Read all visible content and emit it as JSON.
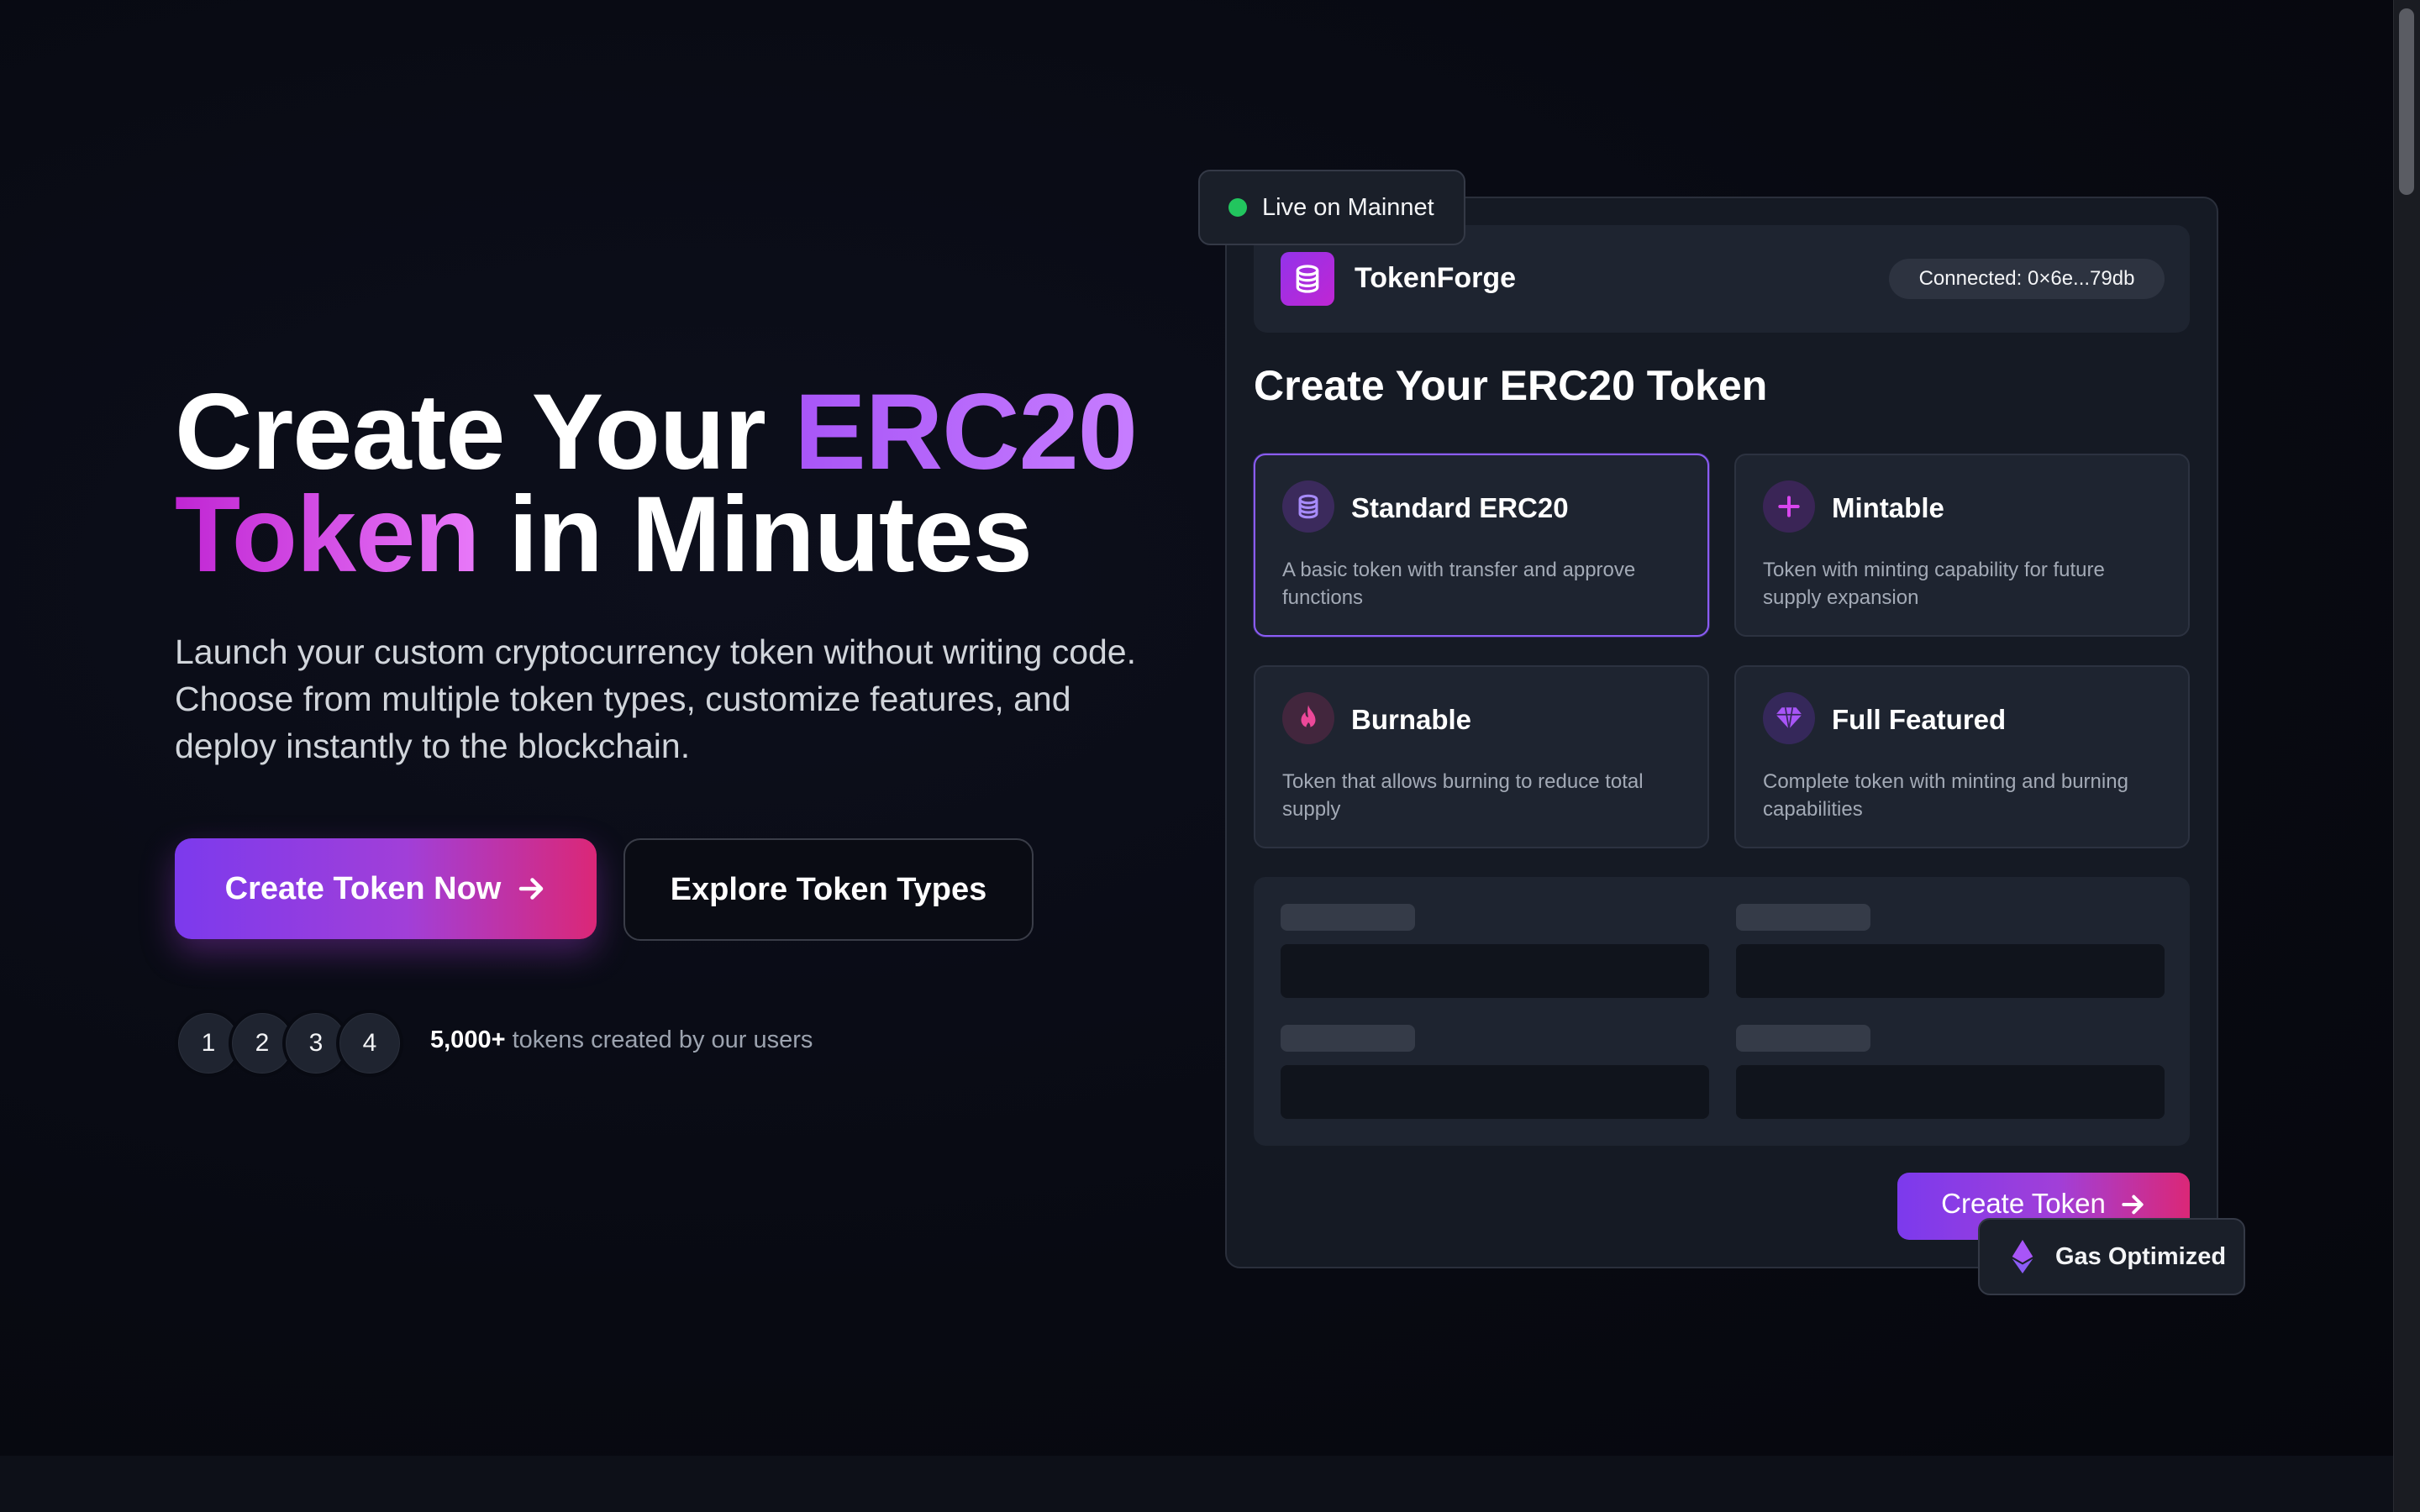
{
  "hero": {
    "title_part1": "Create Your ",
    "title_part2": "ERC20",
    "title_part3": "Token",
    "title_part4": " in Minutes",
    "description": "Launch your custom cryptocurrency token without writing code. Choose from multiple token types, customize features, and deploy instantly to the blockchain.",
    "primary_button": "Create Token Now",
    "secondary_button": "Explore Token Types",
    "avatars": [
      "1",
      "2",
      "3",
      "4"
    ],
    "proof_count": "5,000+",
    "proof_text": " tokens created by our users"
  },
  "card": {
    "live_badge": "Live on Mainnet",
    "brand": "TokenForge",
    "wallet": "Connected: 0×6e...79db",
    "title": "Create Your ERC20 Token",
    "token_types": [
      {
        "name": "Standard ERC20",
        "description": "A basic token with transfer and approve functions",
        "icon": "coins-icon"
      },
      {
        "name": "Mintable",
        "description": "Token with minting capability for future supply expansion",
        "icon": "plus-icon"
      },
      {
        "name": "Burnable",
        "description": "Token that allows burning to reduce total supply",
        "icon": "fire-icon"
      },
      {
        "name": "Full Featured",
        "description": "Complete token with minting and burning capabilities",
        "icon": "gem-icon"
      }
    ],
    "create_button": "Create Token",
    "gas_badge": "Gas Optimized"
  },
  "colors": {
    "accent_purple": "#7c3aed",
    "accent_pink": "#db2777",
    "live_green": "#22c55e",
    "background": "#080a12"
  }
}
